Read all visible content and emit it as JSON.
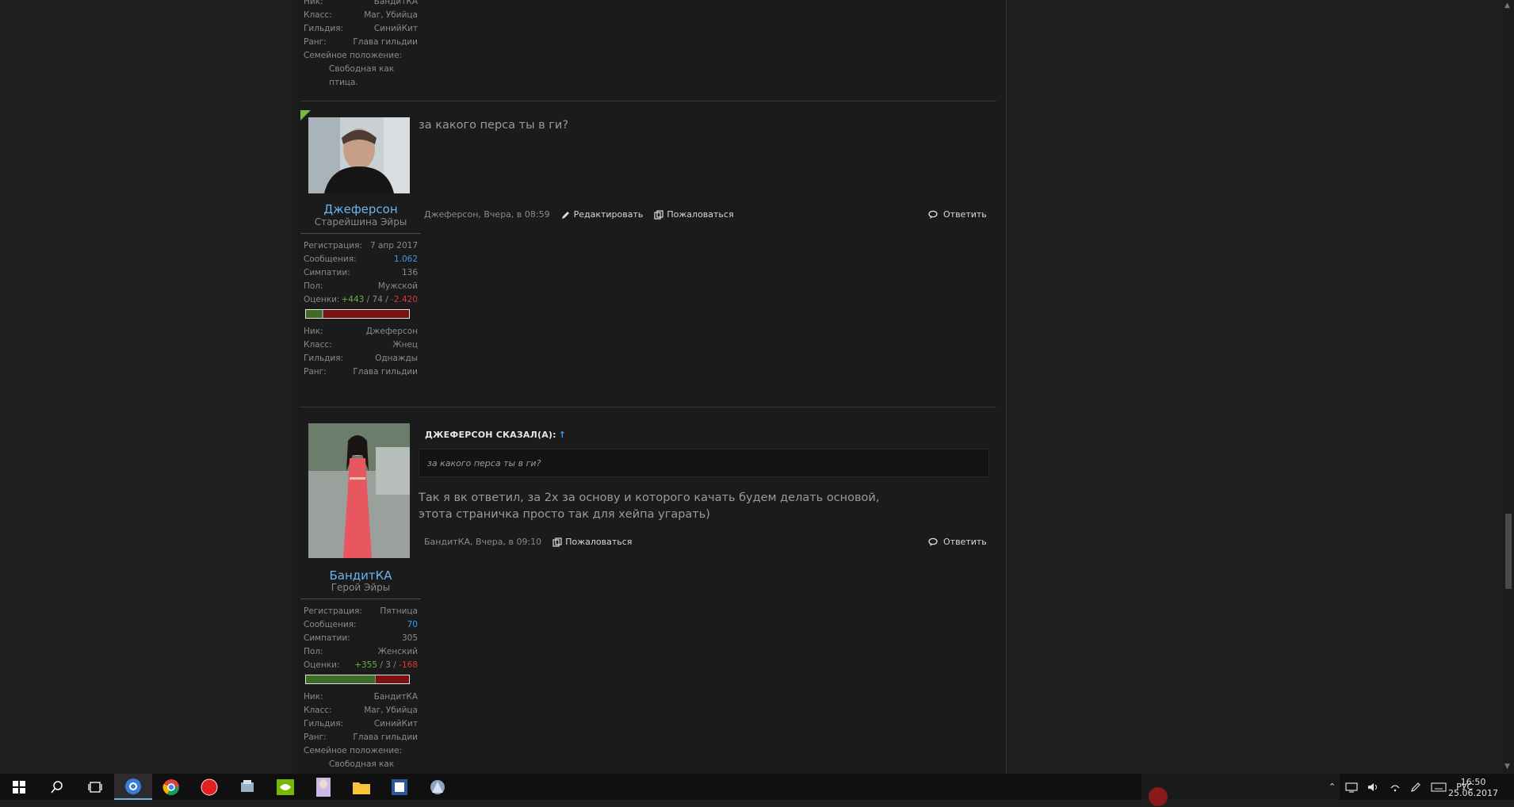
{
  "posts": [
    {
      "partial": true,
      "rows": [
        {
          "k": "Ник:",
          "v": "БандитКА"
        },
        {
          "k": "Класс:",
          "v": "Маг, Убийца"
        },
        {
          "k": "Гильдия:",
          "v": "СинийКит"
        },
        {
          "k": "Ранг:",
          "v": "Глава гильдии"
        }
      ],
      "family_label": "Семейное положение:",
      "family_value": "Свободная как птица."
    },
    {
      "username": "Джеферсон",
      "usertitle": "Старейшина Эйры",
      "stats": [
        {
          "k": "Регистрация:",
          "v": "7 апр 2017"
        },
        {
          "k": "Сообщения:",
          "v": "1.062"
        },
        {
          "k": "Симпатии:",
          "v": "136"
        },
        {
          "k": "Пол:",
          "v": "Мужской"
        }
      ],
      "ratings_label": "Оценки:",
      "ratings": {
        "pos": "+443",
        "neu": "74",
        "neg": "-2.420",
        "pos_share": 0.15,
        "neu_share": 0.02
      },
      "game": [
        {
          "k": "Ник:",
          "v": "Джеферсон"
        },
        {
          "k": "Класс:",
          "v": "Жнец"
        },
        {
          "k": "Гильдия:",
          "v": "Однажды"
        },
        {
          "k": "Ранг:",
          "v": "Глава гильдии"
        }
      ],
      "message": "за какого перса ты в ги?",
      "meta": "Джеферсон, Вчера, в 08:59",
      "edit_label": "Редактировать",
      "report_label": "Пожаловаться",
      "reply_label": "Ответить"
    },
    {
      "username": "БандитКА",
      "usertitle": "Герой Эйры",
      "stats": [
        {
          "k": "Регистрация:",
          "v": "Пятница"
        },
        {
          "k": "Сообщения:",
          "v": "70"
        },
        {
          "k": "Симпатии:",
          "v": "305"
        },
        {
          "k": "Пол:",
          "v": "Женский"
        }
      ],
      "ratings_label": "Оценки:",
      "ratings": {
        "pos": "+355",
        "neu": "3",
        "neg": "-168",
        "pos_share": 0.67,
        "neu_share": 0.01
      },
      "game": [
        {
          "k": "Ник:",
          "v": "БандитКА"
        },
        {
          "k": "Класс:",
          "v": "Маг, Убийца"
        },
        {
          "k": "Гильдия:",
          "v": "СинийКит"
        },
        {
          "k": "Ранг:",
          "v": "Глава гильдии"
        }
      ],
      "family_label": "Семейное положение:",
      "family_value": "Свободная как птица.",
      "quote_header": "ДЖЕФЕРСОН СКАЗАЛ(А):",
      "quote_arrow": "↑",
      "quote_text": "за какого перса ты в ги?",
      "message_line1": "Так я вк ответил, за 2х за основу и которого качать будем делать основой,",
      "message_line2": "этота страничка просто так для хейпа угарать)",
      "meta": "БандитКА, Вчера, в 09:10",
      "report_label": "Пожаловаться",
      "reply_label": "Ответить"
    }
  ],
  "taskbar": {
    "lang": "РУС",
    "time": "16:50",
    "date": "25.06.2017"
  }
}
